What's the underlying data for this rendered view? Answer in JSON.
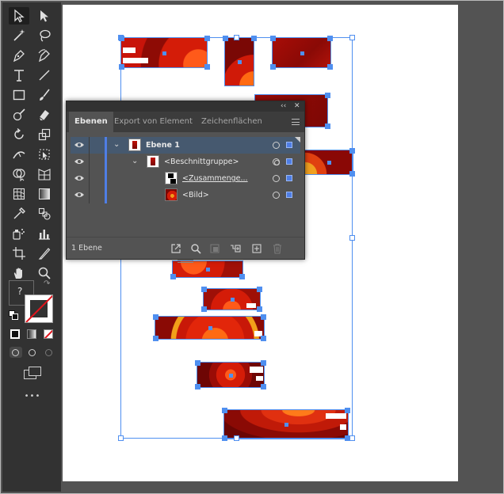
{
  "app": {
    "accent_color": "#4f8ff0",
    "toolbar_color": "#323232",
    "workspace_color": "#535353"
  },
  "toolbar": {
    "tools": [
      {
        "id": "selection",
        "icon": "selection-arrow-icon",
        "selected": true
      },
      {
        "id": "direct-selection",
        "icon": "direct-selection-arrow-icon"
      },
      {
        "id": "magic-wand",
        "icon": "magic-wand-icon"
      },
      {
        "id": "lasso",
        "icon": "lasso-icon"
      },
      {
        "id": "pen",
        "icon": "pen-icon"
      },
      {
        "id": "curvature",
        "icon": "curvature-pen-icon"
      },
      {
        "id": "type",
        "icon": "type-icon"
      },
      {
        "id": "line",
        "icon": "line-segment-icon"
      },
      {
        "id": "rectangle",
        "icon": "rectangle-icon"
      },
      {
        "id": "paintbrush",
        "icon": "paintbrush-icon"
      },
      {
        "id": "shaper",
        "icon": "shaper-icon"
      },
      {
        "id": "eraser",
        "icon": "eraser-icon"
      },
      {
        "id": "rotate",
        "icon": "rotate-icon"
      },
      {
        "id": "scale",
        "icon": "scale-icon"
      },
      {
        "id": "width",
        "icon": "width-tool-icon"
      },
      {
        "id": "free-transform",
        "icon": "free-transform-icon"
      },
      {
        "id": "shape-builder",
        "icon": "shape-builder-icon"
      },
      {
        "id": "perspective-grid",
        "icon": "perspective-grid-icon"
      },
      {
        "id": "mesh",
        "icon": "mesh-icon"
      },
      {
        "id": "gradient",
        "icon": "gradient-icon"
      },
      {
        "id": "eyedropper",
        "icon": "eyedropper-icon"
      },
      {
        "id": "blend",
        "icon": "blend-icon"
      },
      {
        "id": "symbol-sprayer",
        "icon": "symbol-sprayer-icon"
      },
      {
        "id": "column-graph",
        "icon": "column-graph-icon"
      },
      {
        "id": "artboard",
        "icon": "artboard-tool-icon"
      },
      {
        "id": "slice",
        "icon": "slice-icon"
      },
      {
        "id": "hand",
        "icon": "hand-icon"
      },
      {
        "id": "zoom",
        "icon": "zoom-icon"
      }
    ],
    "fill_stroke_help": "?",
    "more_tools": "•••"
  },
  "layers_panel": {
    "collapse_glyph": "‹‹",
    "close_glyph": "✕",
    "tabs": [
      {
        "label": "Ebenen",
        "active": true
      },
      {
        "label": "Export von Element",
        "active": false
      },
      {
        "label": "Zeichenflächen",
        "active": false
      }
    ],
    "rows": [
      {
        "name": "Ebene 1",
        "level": 0,
        "expanded": true,
        "selected": true,
        "target": "single"
      },
      {
        "name": "<Beschnittgruppe>",
        "level": 1,
        "expanded": true,
        "selected": false,
        "target": "double"
      },
      {
        "name": "<Zusammenge...",
        "level": 2,
        "expanded": false,
        "selected": false,
        "target": "single",
        "underline": true
      },
      {
        "name": "<Bild>",
        "level": 2,
        "expanded": false,
        "selected": false,
        "target": "single"
      }
    ],
    "footer": {
      "layer_count": "1 Ebene",
      "icons": [
        "collect-for-export-icon",
        "locate-object-icon",
        "make-clipping-mask-icon",
        "new-sublayer-icon",
        "new-layer-icon",
        "delete-icon"
      ]
    }
  }
}
